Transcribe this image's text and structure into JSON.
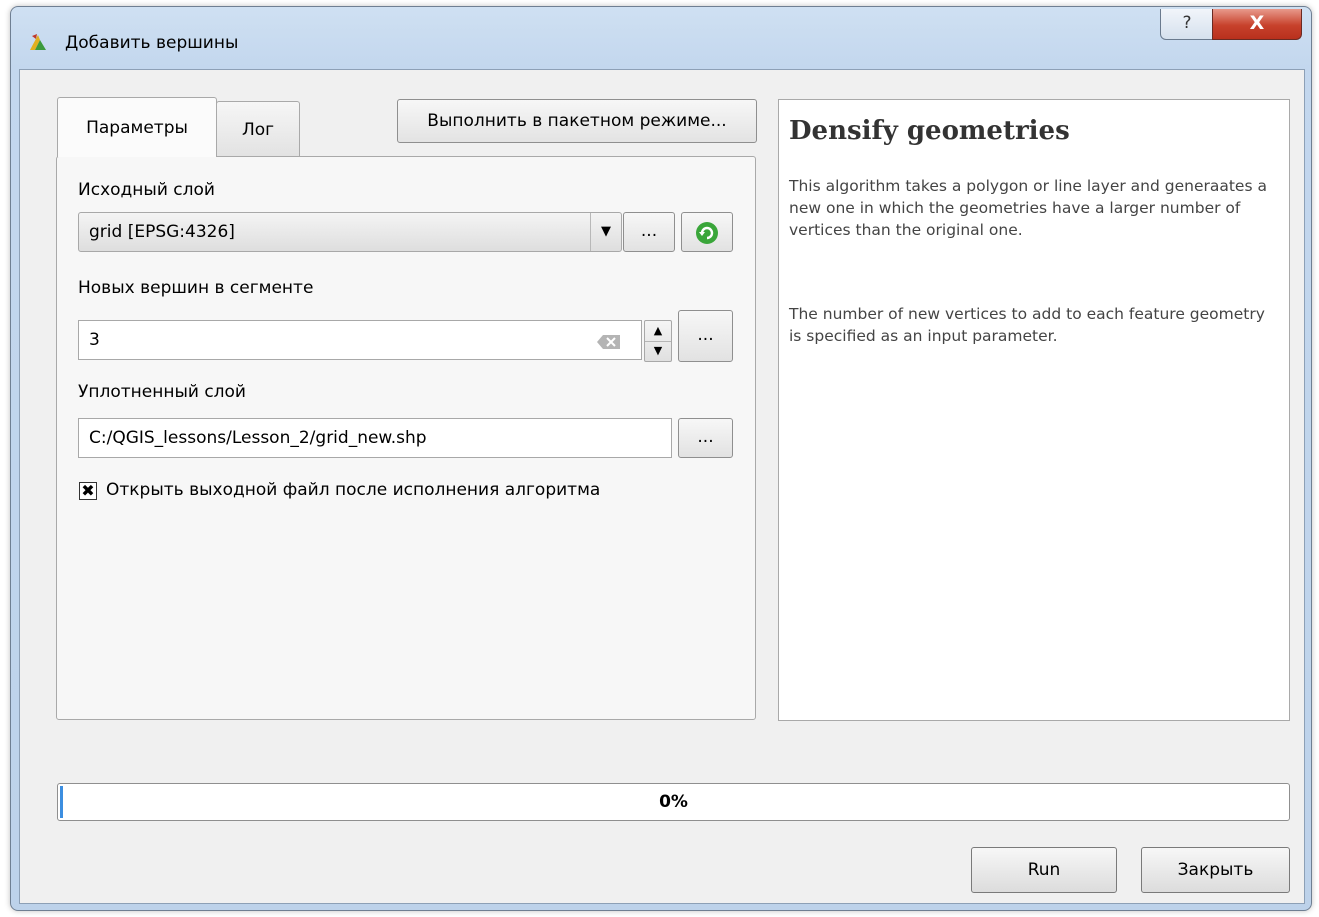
{
  "window": {
    "title": "Добавить вершины",
    "help_label": "?",
    "close_label": "X"
  },
  "tabs": [
    {
      "label": "Параметры",
      "active": true
    },
    {
      "label": "Лог",
      "active": false
    }
  ],
  "batch_button": "Выполнить в пакетном режиме...",
  "params": {
    "input_layer_label": "Исходный слой",
    "input_layer_value": "grid [EPSG:4326]",
    "vertices_label": "Новых вершин в сегменте",
    "vertices_value": "3",
    "output_layer_label": "Уплотненный слой",
    "output_layer_value": "C:/QGIS_lessons/Lesson_2/grid_new.shp",
    "open_output_label": "Открыть выходной файл после исполнения алгоритма",
    "open_output_checked": true,
    "browse_label": "..."
  },
  "help": {
    "title": "Densify geometries",
    "paragraph1": "This algorithm takes a polygon or line layer and generaates a new one in which the geometries have a larger number of vertices than the original one.",
    "paragraph2": "The number of new vertices to add to each feature geometry is specified as an input parameter."
  },
  "progress": {
    "value": 0,
    "text": "0%"
  },
  "buttons": {
    "run": "Run",
    "close": "Закрыть"
  },
  "icons": {
    "app": "qgis-processing-icon",
    "refresh": "refresh-icon",
    "clear": "clear-text-icon",
    "dropdown": "chevron-down-icon"
  },
  "colors": {
    "progress": "#3c8ee0",
    "close_button": "#c7412b",
    "refresh": "#3aa63a"
  }
}
